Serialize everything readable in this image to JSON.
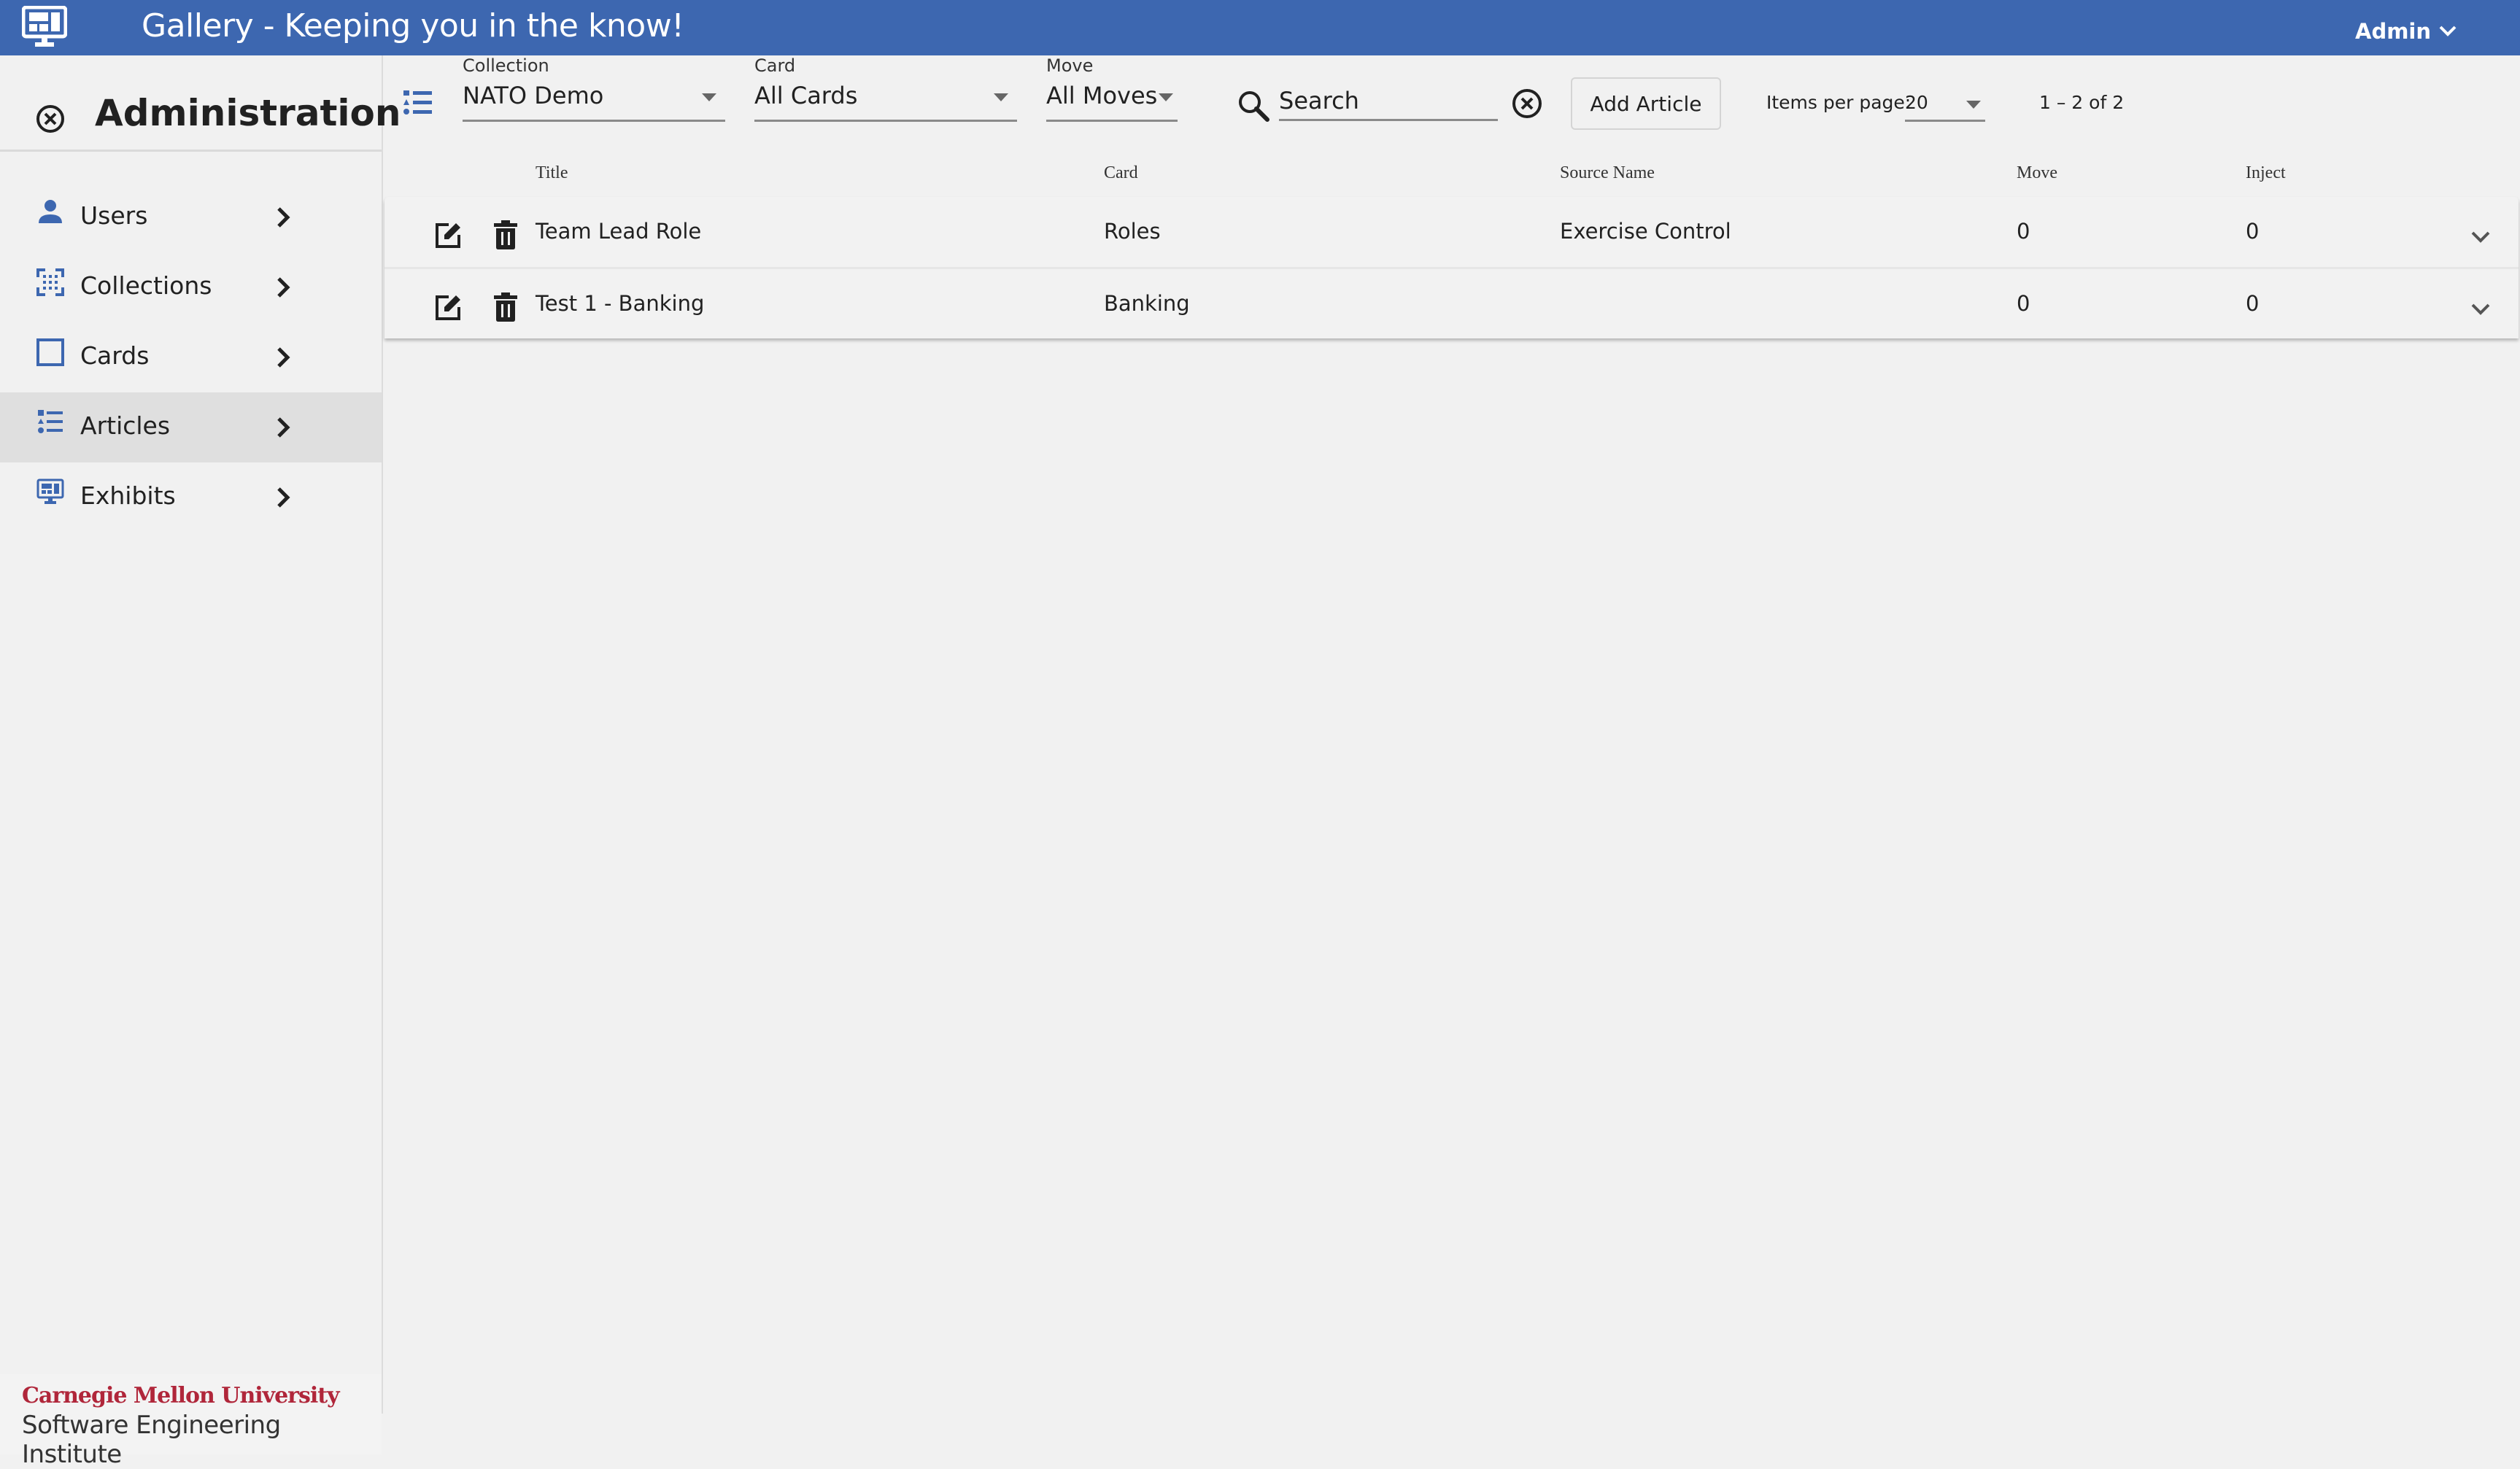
{
  "topbar": {
    "title": "Gallery - Keeping you in the know!",
    "user_menu_label": "Admin",
    "logo_icon": "monitor-dashboard-icon",
    "color": "#3d67b0"
  },
  "sidebar": {
    "heading": "Administration",
    "close_icon": "close-circle-icon",
    "items": [
      {
        "label": "Users",
        "icon": "account-icon",
        "active": false
      },
      {
        "label": "Collections",
        "icon": "collection-grid-icon",
        "active": false
      },
      {
        "label": "Cards",
        "icon": "square-outline-icon",
        "active": false
      },
      {
        "label": "Articles",
        "icon": "format-list-shapes-icon",
        "active": true
      },
      {
        "label": "Exhibits",
        "icon": "monitor-dashboard-icon",
        "active": false
      }
    ],
    "footer": {
      "line1": "Carnegie Mellon University",
      "line2": "Software Engineering Institute"
    }
  },
  "toolbar": {
    "collection": {
      "label": "Collection",
      "value": "NATO Demo"
    },
    "card": {
      "label": "Card",
      "value": "All Cards"
    },
    "move": {
      "label": "Move",
      "value": "All Moves"
    },
    "search": {
      "placeholder": "Search",
      "value": ""
    },
    "add_button": "Add Article",
    "items_per_page_label": "Items per page:",
    "items_per_page_value": "20",
    "range_label": "1 – 2 of 2"
  },
  "table": {
    "columns": [
      "Title",
      "Card",
      "Source Name",
      "Move",
      "Inject"
    ],
    "rows": [
      {
        "title": "Team Lead Role",
        "card": "Roles",
        "source_name": "Exercise Control",
        "move": "0",
        "inject": "0"
      },
      {
        "title": "Test 1 - Banking",
        "card": "Banking",
        "source_name": "",
        "move": "0",
        "inject": "0"
      }
    ]
  }
}
